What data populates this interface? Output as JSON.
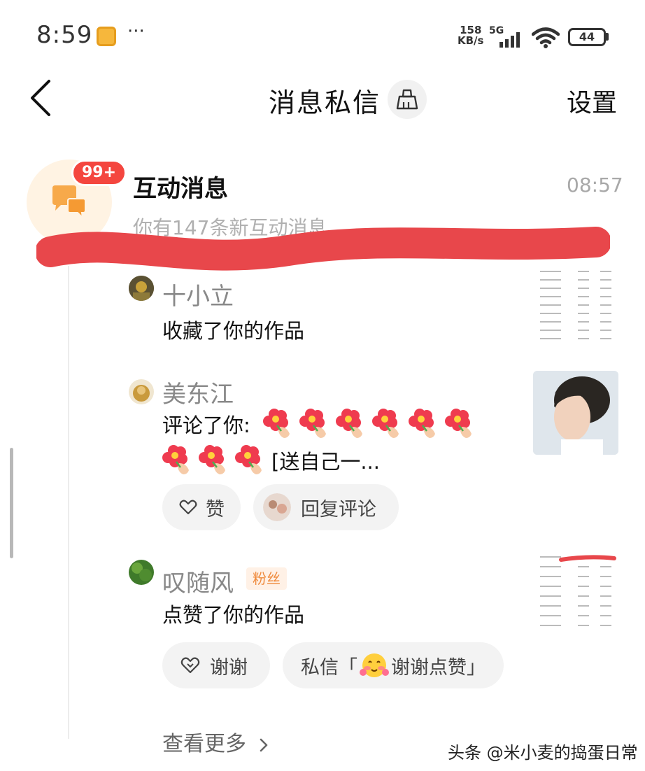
{
  "status_bar": {
    "time": "8:59",
    "dots": "···",
    "net_speed_value": "158",
    "net_speed_unit": "KB/s",
    "network": "5G",
    "battery": "44"
  },
  "header": {
    "title": "消息私信",
    "settings_label": "设置"
  },
  "interaction": {
    "badge": "99+",
    "title": "互动消息",
    "time": "08:57",
    "subtitle": "你有147条新互动消息"
  },
  "notifications": [
    {
      "user": "十小立",
      "action": "收藏了你的作品"
    },
    {
      "user": "美东江",
      "action_prefix": "评论了你:",
      "action_suffix": "[送自己一...",
      "like_label": "赞",
      "reply_label": "回复评论"
    },
    {
      "user": "叹随风",
      "tag": "粉丝",
      "action": "点赞了你的作品",
      "thanks_label": "谢谢",
      "dm_prefix": "私信「",
      "dm_text": "谢谢点赞」"
    }
  ],
  "see_more": "查看更多",
  "watermark": "头条 @米小麦的捣蛋日常",
  "colors": {
    "badge": "#f4463f",
    "scribble": "#e8474b",
    "fan_tag_text": "#ef8a3c",
    "interaction_icon": "#f7a94a"
  }
}
